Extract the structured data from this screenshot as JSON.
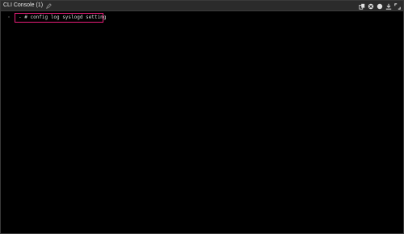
{
  "window": {
    "title": "CLI Console (1)"
  },
  "toolbar": {
    "buttons": [
      {
        "name": "copy-icon"
      },
      {
        "name": "clear-icon"
      },
      {
        "name": "circle-icon"
      },
      {
        "name": "download-icon"
      },
      {
        "name": "maximize-icon"
      }
    ]
  },
  "console": {
    "prompt": "- # ",
    "command": "config log syslogd setting",
    "highlight_color": "#ea1e7a"
  }
}
